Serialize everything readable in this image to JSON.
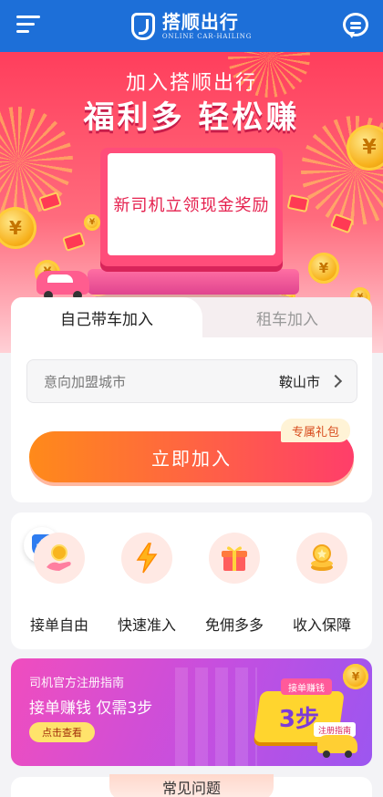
{
  "header": {
    "brand_name": "搭顺出行",
    "brand_sub": "ONLINE CAR-HAILING"
  },
  "hero": {
    "subtitle": "加入搭顺出行",
    "title": "福利多 轻松赚",
    "board_text": "新司机立领现金奖励"
  },
  "join": {
    "tabs": [
      {
        "label": "自己带车加入"
      },
      {
        "label": "租车加入"
      }
    ],
    "city_label": "意向加盟城市",
    "city_value": "鞍山市",
    "gift_badge": "专属礼包",
    "join_button": "立即加入"
  },
  "features": {
    "items": [
      {
        "label": "接单自由",
        "icon": "hand-coin-icon"
      },
      {
        "label": "快速准入",
        "icon": "lightning-icon"
      },
      {
        "label": "免佣多多",
        "icon": "gift-icon"
      },
      {
        "label": "收入保障",
        "icon": "coin-stack-icon"
      }
    ]
  },
  "guide": {
    "title": "司机官方注册指南",
    "main": "接单赚钱 仅需3步",
    "button": "点击查看",
    "tag": "接单赚钱",
    "steps": "3步",
    "badge": "注册指南"
  },
  "faq": {
    "title": "常见问题"
  },
  "colors": {
    "header_blue": "#1d6fd8",
    "hero_red": "#ff3e5c",
    "join_gradient_start": "#ff8a1a",
    "join_gradient_end": "#ff3e6a",
    "guide_purple": "#c44fe0"
  }
}
